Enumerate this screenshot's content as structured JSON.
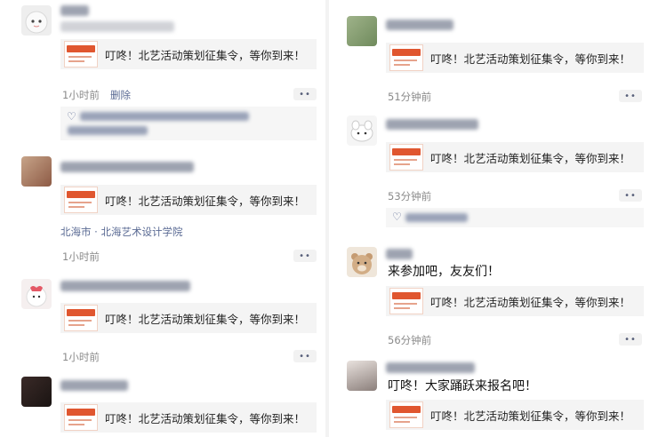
{
  "card_text": "叮咚！北艺活动策划征集令，等你到来！",
  "left": {
    "posts": [
      {
        "time": "1小时前",
        "delete": "删除",
        "more": "••"
      },
      {
        "location": "北海市 · 北海艺术设计学院",
        "time": "1小时前",
        "more": "••"
      },
      {
        "time": "1小时前",
        "more": "••"
      },
      {}
    ]
  },
  "right": {
    "posts": [
      {
        "time": "51分钟前",
        "more": "••"
      },
      {
        "time": "53分钟前",
        "more": "••"
      },
      {
        "comment": "来参加吧，友友们！",
        "time": "56分钟前",
        "more": "••"
      },
      {
        "comment": "叮咚！大家踊跃来报名吧！"
      }
    ]
  },
  "icons": {
    "like": "heart-icon",
    "more": "more-dots-icon"
  },
  "colors": {
    "link": "#5b6b94",
    "thumb_red": "#e0562f",
    "card_bg": "#f4f4f4"
  }
}
